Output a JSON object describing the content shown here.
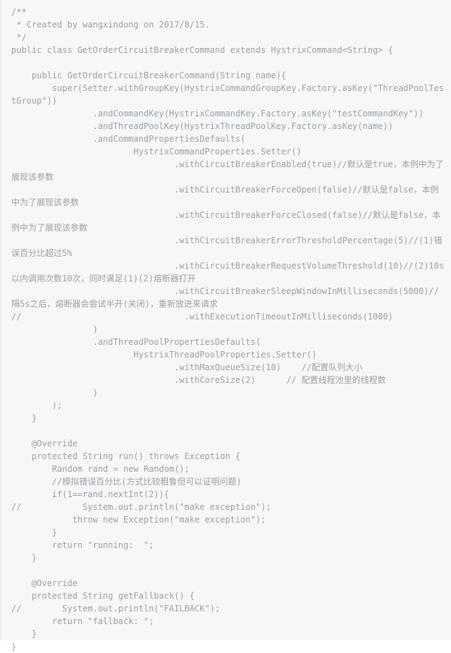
{
  "code_block": {
    "language": "java",
    "background_color": "#f7f7f7",
    "text_color": "#9aa0a6",
    "left_rule_color": "#ececec",
    "lines": [
      "/**",
      " * Created by wangxindong on 2017/8/15.",
      " */",
      "public class GetOrderCircuitBreakerCommand extends HystrixCommand<String> {",
      "",
      "    public GetOrderCircuitBreakerCommand(String name){",
      "        super(Setter.withGroupKey(HystrixCommandGroupKey.Factory.asKey(\"ThreadPoolTestGroup\"))",
      "                .andCommandKey(HystrixCommandKey.Factory.asKey(\"testCommandKey\"))",
      "                .andThreadPoolKey(HystrixThreadPoolKey.Factory.asKey(name))",
      "                .andCommandPropertiesDefaults(",
      "                        HystrixCommandProperties.Setter()",
      "                                .withCircuitBreakerEnabled(true)//默认是true，本例中为了展现该参数",
      "                                .withCircuitBreakerForceOpen(false)//默认是false，本例中为了展现该参数",
      "                                .withCircuitBreakerForceClosed(false)//默认是false，本例中为了展现该参数",
      "                                .withCircuitBreakerErrorThresholdPercentage(5)//(1)错误百分比超过5%",
      "                                .withCircuitBreakerRequestVolumeThreshold(10)//(2)10s以内调用次数10次，同时满足(1)(2)熔断器打开",
      "                                .withCircuitBreakerSleepWindowInMilliseconds(5000)//隔5s之后，熔断器会尝试半开(关闭)，重新放进来请求",
      "//                                .withExecutionTimeoutInMilliseconds(1000)",
      "                )",
      "                .andThreadPoolPropertiesDefaults(",
      "                        HystrixThreadPoolProperties.Setter()",
      "                                .withMaxQueueSize(10)    //配置队列大小",
      "                                .withCoreSize(2)      // 配置线程池里的线程数",
      "                )",
      "        );",
      "    }",
      "",
      "    @Override",
      "    protected String run() throws Exception {",
      "        Random rand = new Random();",
      "        //模拟错误百分比(方式比较粗鲁但可以证明问题)",
      "        if(1==rand.nextInt(2)){",
      "//            System.out.println(\"make exception\");",
      "            throw new Exception(\"make exception\");",
      "        }",
      "        return \"running:  \";",
      "    }",
      "",
      "    @Override",
      "    protected String getFallback() {",
      "//        System.out.println(\"FAILBACK\");",
      "        return \"fallback: \";",
      "    }",
      "}"
    ]
  }
}
